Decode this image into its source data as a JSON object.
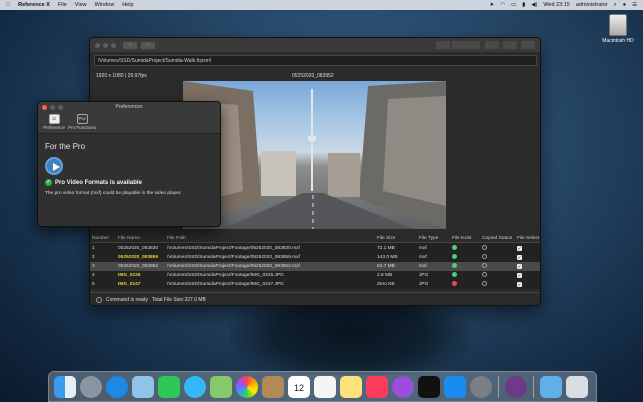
{
  "menubar": {
    "app_name": "Reference X",
    "menus": [
      "File",
      "View",
      "Window",
      "Help"
    ],
    "clock": "Wed 23:15",
    "user": "administrator"
  },
  "desktop": {
    "disk_label": "Macintosh HD"
  },
  "main_window": {
    "nav_back": "‹",
    "nav_forward": "›",
    "path": "/Volumes/SSD/SumidaProject/Sumida-Walk.fcpxml",
    "resolution": "1920 x 1080 | 29.97fps",
    "clip_name": "05252020_083952",
    "table": {
      "headers": [
        "Number",
        "File Name",
        "File Path",
        "File Size",
        "File Type",
        "File Exist",
        "Copied Status",
        "File Select"
      ],
      "rows": [
        {
          "num": "1",
          "name": "05252020_083830",
          "path": "/Volumes/SSD/SumidaProject/Footage/05252020_083830.mxf",
          "size": "72.1 MB",
          "type": "mxf",
          "exist": "green",
          "highlight": false,
          "selected": false
        },
        {
          "num": "2",
          "name": "05252020_083859",
          "path": "/Volumes/SSD/SumidaProject/Footage/05252020_083859.mxf",
          "size": "143.0 MB",
          "type": "mxf",
          "exist": "green",
          "highlight": true,
          "selected": false
        },
        {
          "num": "3",
          "name": "05252020_083952",
          "path": "/Volumes/SSD/SumidaProject/Footage/05252020_083952.mxf",
          "size": "84.7 MB",
          "type": "mxf",
          "exist": "green",
          "highlight": false,
          "selected": true
        },
        {
          "num": "4",
          "name": "IMG_0225",
          "path": "/Volumes/SSD/SumidaProject/Footage/IMG_0225.JPG",
          "size": "2.6 MB",
          "type": "JPG",
          "exist": "green",
          "highlight": true,
          "selected": false
        },
        {
          "num": "5",
          "name": "IMG_0247",
          "path": "/Volumes/SSD/SumidaProject/Footage/IMG_0247.JPG",
          "size": "Zero KB",
          "type": "JPG",
          "exist": "red",
          "highlight": true,
          "selected": false
        }
      ]
    },
    "status": "Command is ready",
    "total_size": "Total File Size:327.0 MB"
  },
  "preferences": {
    "title": "Preferences",
    "tabs": [
      {
        "label": "Preference",
        "icon": "switch-icon"
      },
      {
        "label": "Pro Functions",
        "icon": "pro-icon",
        "glyph": "Pro"
      }
    ],
    "heading": "For the Pro",
    "available": "Pro Video Formats is available",
    "description": "The pro video format (mxf) could be playable in the video player."
  },
  "colors": {
    "exist_green": "#4ccf7d",
    "exist_red": "#e8485a",
    "highlight_yellow": "#e8d233",
    "check_green": "#29b34b"
  },
  "dock_apps": [
    "Finder",
    "Launchpad",
    "Safari",
    "Preview",
    "FaceTime",
    "Messages",
    "Maps",
    "Photos",
    "Contacts",
    "Calendar",
    "Reminders",
    "Notes",
    "Music",
    "Podcasts",
    "TV",
    "App Store",
    "System Preferences",
    "Reference X",
    "Downloads",
    "Trash"
  ],
  "calendar_day": "12"
}
